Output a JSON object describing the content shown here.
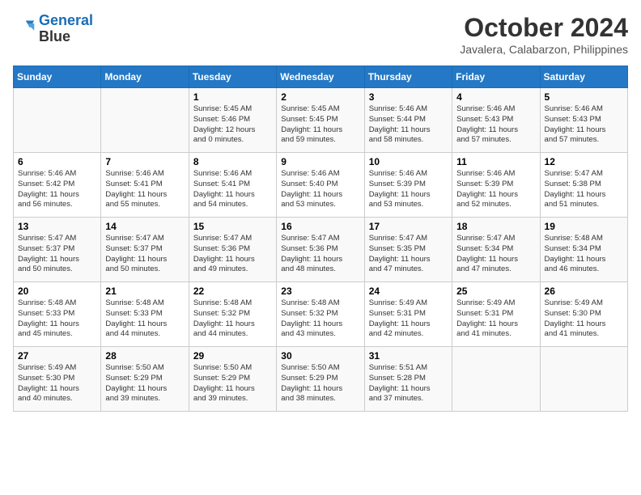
{
  "header": {
    "logo_line1": "General",
    "logo_line2": "Blue",
    "month": "October 2024",
    "location": "Javalera, Calabarzon, Philippines"
  },
  "columns": [
    "Sunday",
    "Monday",
    "Tuesday",
    "Wednesday",
    "Thursday",
    "Friday",
    "Saturday"
  ],
  "weeks": [
    [
      {
        "day": "",
        "info": ""
      },
      {
        "day": "",
        "info": ""
      },
      {
        "day": "1",
        "info": "Sunrise: 5:45 AM\nSunset: 5:46 PM\nDaylight: 12 hours\nand 0 minutes."
      },
      {
        "day": "2",
        "info": "Sunrise: 5:45 AM\nSunset: 5:45 PM\nDaylight: 11 hours\nand 59 minutes."
      },
      {
        "day": "3",
        "info": "Sunrise: 5:46 AM\nSunset: 5:44 PM\nDaylight: 11 hours\nand 58 minutes."
      },
      {
        "day": "4",
        "info": "Sunrise: 5:46 AM\nSunset: 5:43 PM\nDaylight: 11 hours\nand 57 minutes."
      },
      {
        "day": "5",
        "info": "Sunrise: 5:46 AM\nSunset: 5:43 PM\nDaylight: 11 hours\nand 57 minutes."
      }
    ],
    [
      {
        "day": "6",
        "info": "Sunrise: 5:46 AM\nSunset: 5:42 PM\nDaylight: 11 hours\nand 56 minutes."
      },
      {
        "day": "7",
        "info": "Sunrise: 5:46 AM\nSunset: 5:41 PM\nDaylight: 11 hours\nand 55 minutes."
      },
      {
        "day": "8",
        "info": "Sunrise: 5:46 AM\nSunset: 5:41 PM\nDaylight: 11 hours\nand 54 minutes."
      },
      {
        "day": "9",
        "info": "Sunrise: 5:46 AM\nSunset: 5:40 PM\nDaylight: 11 hours\nand 53 minutes."
      },
      {
        "day": "10",
        "info": "Sunrise: 5:46 AM\nSunset: 5:39 PM\nDaylight: 11 hours\nand 53 minutes."
      },
      {
        "day": "11",
        "info": "Sunrise: 5:46 AM\nSunset: 5:39 PM\nDaylight: 11 hours\nand 52 minutes."
      },
      {
        "day": "12",
        "info": "Sunrise: 5:47 AM\nSunset: 5:38 PM\nDaylight: 11 hours\nand 51 minutes."
      }
    ],
    [
      {
        "day": "13",
        "info": "Sunrise: 5:47 AM\nSunset: 5:37 PM\nDaylight: 11 hours\nand 50 minutes."
      },
      {
        "day": "14",
        "info": "Sunrise: 5:47 AM\nSunset: 5:37 PM\nDaylight: 11 hours\nand 50 minutes."
      },
      {
        "day": "15",
        "info": "Sunrise: 5:47 AM\nSunset: 5:36 PM\nDaylight: 11 hours\nand 49 minutes."
      },
      {
        "day": "16",
        "info": "Sunrise: 5:47 AM\nSunset: 5:36 PM\nDaylight: 11 hours\nand 48 minutes."
      },
      {
        "day": "17",
        "info": "Sunrise: 5:47 AM\nSunset: 5:35 PM\nDaylight: 11 hours\nand 47 minutes."
      },
      {
        "day": "18",
        "info": "Sunrise: 5:47 AM\nSunset: 5:34 PM\nDaylight: 11 hours\nand 47 minutes."
      },
      {
        "day": "19",
        "info": "Sunrise: 5:48 AM\nSunset: 5:34 PM\nDaylight: 11 hours\nand 46 minutes."
      }
    ],
    [
      {
        "day": "20",
        "info": "Sunrise: 5:48 AM\nSunset: 5:33 PM\nDaylight: 11 hours\nand 45 minutes."
      },
      {
        "day": "21",
        "info": "Sunrise: 5:48 AM\nSunset: 5:33 PM\nDaylight: 11 hours\nand 44 minutes."
      },
      {
        "day": "22",
        "info": "Sunrise: 5:48 AM\nSunset: 5:32 PM\nDaylight: 11 hours\nand 44 minutes."
      },
      {
        "day": "23",
        "info": "Sunrise: 5:48 AM\nSunset: 5:32 PM\nDaylight: 11 hours\nand 43 minutes."
      },
      {
        "day": "24",
        "info": "Sunrise: 5:49 AM\nSunset: 5:31 PM\nDaylight: 11 hours\nand 42 minutes."
      },
      {
        "day": "25",
        "info": "Sunrise: 5:49 AM\nSunset: 5:31 PM\nDaylight: 11 hours\nand 41 minutes."
      },
      {
        "day": "26",
        "info": "Sunrise: 5:49 AM\nSunset: 5:30 PM\nDaylight: 11 hours\nand 41 minutes."
      }
    ],
    [
      {
        "day": "27",
        "info": "Sunrise: 5:49 AM\nSunset: 5:30 PM\nDaylight: 11 hours\nand 40 minutes."
      },
      {
        "day": "28",
        "info": "Sunrise: 5:50 AM\nSunset: 5:29 PM\nDaylight: 11 hours\nand 39 minutes."
      },
      {
        "day": "29",
        "info": "Sunrise: 5:50 AM\nSunset: 5:29 PM\nDaylight: 11 hours\nand 39 minutes."
      },
      {
        "day": "30",
        "info": "Sunrise: 5:50 AM\nSunset: 5:29 PM\nDaylight: 11 hours\nand 38 minutes."
      },
      {
        "day": "31",
        "info": "Sunrise: 5:51 AM\nSunset: 5:28 PM\nDaylight: 11 hours\nand 37 minutes."
      },
      {
        "day": "",
        "info": ""
      },
      {
        "day": "",
        "info": ""
      }
    ]
  ]
}
